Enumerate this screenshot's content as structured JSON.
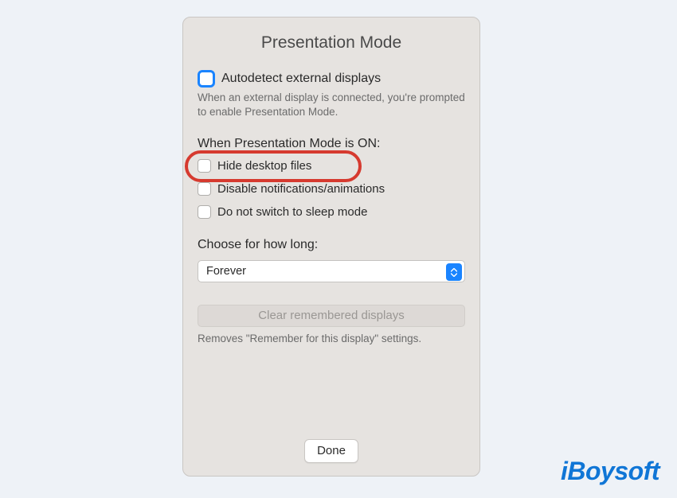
{
  "panel": {
    "title": "Presentation Mode",
    "autodetect": {
      "label": "Autodetect external displays",
      "description": "When an external display is connected, you're prompted to enable Presentation Mode."
    },
    "when_on_label": "When Presentation Mode is ON:",
    "options": [
      {
        "label": "Hide desktop files",
        "highlighted": true
      },
      {
        "label": "Disable notifications/animations",
        "highlighted": false
      },
      {
        "label": "Do not switch to sleep mode",
        "highlighted": false
      }
    ],
    "duration": {
      "label": "Choose for how long:",
      "value": "Forever"
    },
    "clear": {
      "button": "Clear remembered displays",
      "description": "Removes \"Remember for this display\" settings."
    },
    "done": "Done"
  },
  "brand": "iBoysoft"
}
